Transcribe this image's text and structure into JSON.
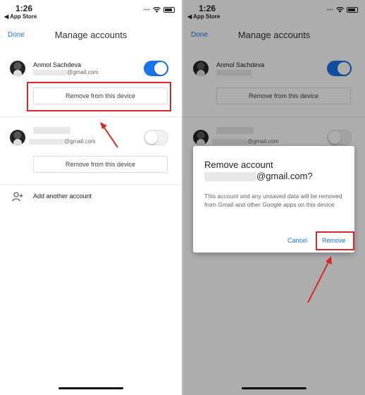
{
  "status": {
    "time": "1:26",
    "back_app": "◀ App Store",
    "signal": "••••"
  },
  "header": {
    "done_label": "Done",
    "title": "Manage accounts"
  },
  "accounts": [
    {
      "name": "Anmol Sachdeva",
      "email_suffix": "@gmail.com",
      "toggle": "on",
      "remove_label": "Remove from this device"
    },
    {
      "name": "",
      "email_suffix": "@gmail.com",
      "toggle": "off",
      "remove_label": "Remove from this device"
    }
  ],
  "add_account_label": "Add another account",
  "dialog": {
    "title": "Remove account",
    "email_suffix": "@gmail.com?",
    "body": "This account and any unsaved data will be removed from Gmail and other Google apps on this device",
    "cancel_label": "Cancel",
    "remove_label": "Remove"
  },
  "colors": {
    "accent": "#1a73e8",
    "highlight": "#d62828"
  },
  "icons": [
    "wifi-icon",
    "battery-icon",
    "add-person-icon",
    "arrow-icon"
  ]
}
